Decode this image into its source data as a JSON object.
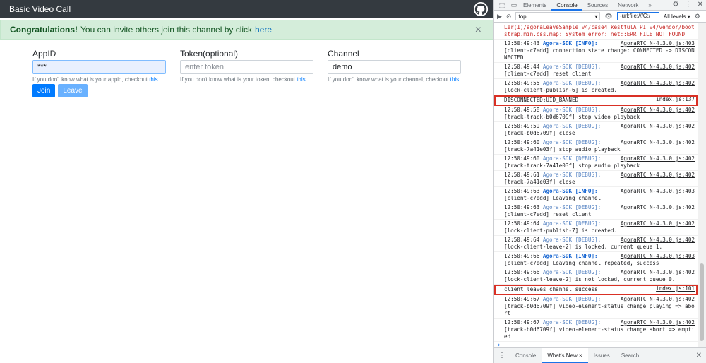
{
  "app": {
    "title": "Basic Video Call",
    "alert": {
      "strong": "Congratulations!",
      "text": "You can invite others join this channel by click",
      "link": "here",
      "close": "×"
    },
    "fields": [
      {
        "label": "AppID",
        "value": "***",
        "placeholder": "",
        "help": "If you don't know what is your appid, checkout",
        "help_link": "this"
      },
      {
        "label": "Token(optional)",
        "value": "",
        "placeholder": "enter token",
        "help": "If you don't know what is your token, checkout",
        "help_link": "this"
      },
      {
        "label": "Channel",
        "value": "demo",
        "placeholder": "",
        "help": "If you don't know what is your channel, checkout",
        "help_link": "this"
      }
    ],
    "buttons": {
      "join": "Join",
      "leave": "Leave"
    }
  },
  "devtools": {
    "tabs": [
      "Elements",
      "Console",
      "Sources",
      "Network"
    ],
    "more": "»",
    "context": "top",
    "filter": "-url:file:///C:/",
    "levels": "All levels ▾",
    "messages": [
      {
        "kind": "err",
        "text": "Ler(1)/agoraLeaveSample_v4/case4_kestfulA PI_v4/vendor/bootstrap.min.css.map: System error: net::ERR_FILE_NOT_FOUND"
      },
      {
        "ts": "12:50:49:43",
        "tag": "Agora-SDK [INFO]:",
        "level": "info",
        "src": "AgoraRTC_N-4.3.0.js:403",
        "body": "[client-c7edd] connection state change: CONNECTED -> DISCONNECTED"
      },
      {
        "ts": "12:50:49:44",
        "tag": "Agora-SDK [DEBUG]:",
        "level": "dbg",
        "src": "AgoraRTC_N-4.3.0.js:402",
        "body": "[client-c7edd] reset client"
      },
      {
        "ts": "12:50:49:55",
        "tag": "Agora-SDK [DEBUG]:",
        "level": "dbg",
        "src": "AgoraRTC_N-4.3.0.js:402",
        "body": "[lock-client-publish-6] is created."
      },
      {
        "kind": "hl",
        "body": "DISCONNECTED:UID_BANNED",
        "src": "index.js:137"
      },
      {
        "ts": "12:50:49:58",
        "tag": "Agora-SDK [DEBUG]:",
        "level": "dbg",
        "src": "AgoraRTC_N-4.3.0.js:402",
        "body": "[track-track-b0d6709f] stop video playback"
      },
      {
        "ts": "12:50:49:59",
        "tag": "Agora-SDK [DEBUG]:",
        "level": "dbg",
        "src": "AgoraRTC_N-4.3.0.js:402",
        "body": "[track-b0d6709f] close"
      },
      {
        "ts": "12:50:49:60",
        "tag": "Agora-SDK [DEBUG]:",
        "level": "dbg",
        "src": "AgoraRTC_N-4.3.0.js:402",
        "body": "[track-7a41e03f] stop audio playback"
      },
      {
        "ts": "12:50:49:60",
        "tag": "Agora-SDK [DEBUG]:",
        "level": "dbg",
        "src": "AgoraRTC_N-4.3.0.js:402",
        "body": "[track-track-7a41e03f] stop audio playback"
      },
      {
        "ts": "12:50:49:61",
        "tag": "Agora-SDK [DEBUG]:",
        "level": "dbg",
        "src": "AgoraRTC_N-4.3.0.js:402",
        "body": "[track-7a41e03f] close"
      },
      {
        "ts": "12:50:49:63",
        "tag": "Agora-SDK [INFO]:",
        "level": "info",
        "src": "AgoraRTC_N-4.3.0.js:403",
        "body": "[client-c7edd] Leaving channel"
      },
      {
        "ts": "12:50:49:63",
        "tag": "Agora-SDK [DEBUG]:",
        "level": "dbg",
        "src": "AgoraRTC_N-4.3.0.js:402",
        "body": "[client-c7edd] reset client"
      },
      {
        "ts": "12:50:49:64",
        "tag": "Agora-SDK [DEBUG]:",
        "level": "dbg",
        "src": "AgoraRTC_N-4.3.0.js:402",
        "body": "[lock-client-publish-7] is created."
      },
      {
        "ts": "12:50:49:64",
        "tag": "Agora-SDK [DEBUG]:",
        "level": "dbg",
        "src": "AgoraRTC_N-4.3.0.js:402",
        "body": "[lock-client-leave-2] is locked, current queue 1."
      },
      {
        "ts": "12:50:49:66",
        "tag": "Agora-SDK [INFO]:",
        "level": "info",
        "src": "AgoraRTC_N-4.3.0.js:403",
        "body": "[client-c7edd] Leaving channel repeated, success"
      },
      {
        "ts": "12:50:49:66",
        "tag": "Agora-SDK [DEBUG]:",
        "level": "dbg",
        "src": "AgoraRTC_N-4.3.0.js:402",
        "body": "[lock-client-leave-2] is not locked, current queue 0."
      },
      {
        "kind": "hl",
        "body": "client leaves channel success",
        "src": "index.js:101"
      },
      {
        "ts": "12:50:49:67",
        "tag": "Agora-SDK [DEBUG]:",
        "level": "dbg",
        "src": "AgoraRTC_N-4.3.0.js:402",
        "body": "[track-b0d6709f] video-element-status change playing => abort"
      },
      {
        "ts": "12:50:49:67",
        "tag": "Agora-SDK [DEBUG]:",
        "level": "dbg",
        "src": "AgoraRTC_N-4.3.0.js:402",
        "body": "[track-b0d6709f] video-element-status change abort => emptied"
      }
    ],
    "prompt": "›",
    "drawer": {
      "tabs": [
        "Console",
        "What's New ×",
        "Issues",
        "Search"
      ],
      "close": "✕"
    }
  }
}
